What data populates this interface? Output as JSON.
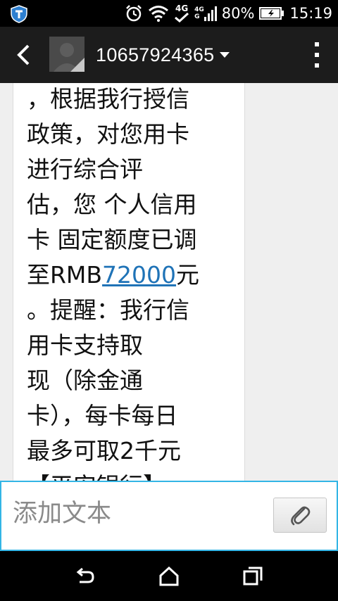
{
  "status_bar": {
    "network_type": "4G",
    "network_small_top": "4G",
    "network_small_bottom": "G",
    "battery_percent": "80%",
    "time": "15:19"
  },
  "header": {
    "contact_number": "10657924365"
  },
  "message": {
    "lines": [
      "，根据我行授信",
      "政策，对您用卡",
      "进行综合评",
      "估，您 个人信用",
      "卡 固定额度已调",
      "至RMB",
      "元",
      "。提醒：我行信",
      "用卡支持取",
      "现（除金通",
      "卡），每卡每日",
      "最多可取2千元",
      "【平安银行】"
    ],
    "amount_link": "72000"
  },
  "composer": {
    "placeholder": "添加文本"
  },
  "icons": {
    "status": [
      "shield-icon",
      "alarm-icon",
      "wifi-icon",
      "check-icon",
      "signal-icon",
      "battery-icon"
    ],
    "header": [
      "back-icon",
      "avatar-icon",
      "dropdown-icon",
      "overflow-menu-icon"
    ],
    "composer": [
      "paperclip-icon"
    ],
    "nav": [
      "back-nav-icon",
      "home-icon",
      "recent-apps-icon"
    ]
  },
  "colors": {
    "accent": "#33b5e5",
    "link": "#1f73b7"
  }
}
